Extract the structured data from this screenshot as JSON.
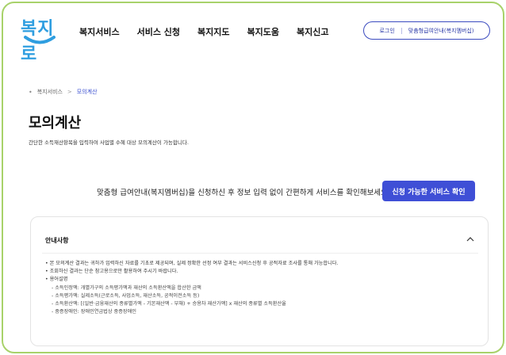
{
  "header": {
    "logo_text": "복지로",
    "nav": [
      "복지서비스",
      "서비스 신청",
      "복지지도",
      "복지도움",
      "복지신고"
    ],
    "login_label": "로그인",
    "custom_guide_label": "맞춤형급여안내(복지멤버십)"
  },
  "breadcrumb": {
    "items": [
      "복지서비스",
      "모의계산"
    ]
  },
  "page": {
    "title": "모의계산",
    "description": "간단한 소득재산항목을 입력하여 사업별 수혜 대상 모의계산이 가능합니다."
  },
  "cta": {
    "text": "맞춤형 급여안내(복지멤버십)을 신청하신 후 정보 입력 없이 간편하게 서비스를 확인해보세요!",
    "button_label": "신청 가능한 서비스 확인"
  },
  "info_panel": {
    "title": "안내사항",
    "bullets": [
      "• 본 모의계산 결과는 귀하가 입력하신 자료를 기초로 제공되며, 실제 정확한 선정 여부 결과는 서비스신청 후 공적자료 조사를 통해 가능합니다.",
      "• 조회하신 결과는 단순 참고용으로만 활용하여 주시기 바랍니다.",
      "• 용어설명"
    ],
    "terms": [
      "- 소득인정액: 개별가구의 소득평가액과 재산의 소득환산액을 합산한 금액",
      "- 소득평가액: 실제소득(근로소득, 사업소득, 재산소득, 공적이전소득 등)",
      "- 소득환산액: [(일반·금융재산의 종류별가액 - 기본재산액 - 부채) + 승용차 재산가액] x 재산의 종류별 소득환산율",
      "- 중증장애인: 장애인연금법상 중증장애인"
    ]
  },
  "colors": {
    "accent": "#3f4fd6",
    "frame_border": "#a8d26a",
    "logo_blue": "#2f9ee0"
  }
}
